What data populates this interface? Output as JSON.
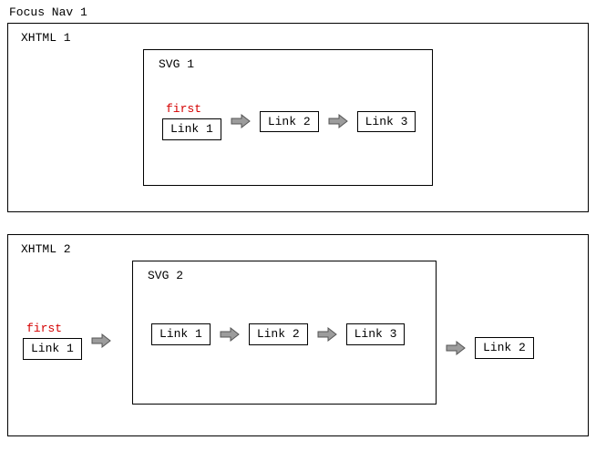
{
  "page_title": "Focus Nav 1",
  "box1": {
    "label": "XHTML 1",
    "svg_label": "SVG 1",
    "first_label": "first",
    "links": [
      "Link 1",
      "Link 2",
      "Link 3"
    ]
  },
  "box2": {
    "label": "XHTML 2",
    "svg_label": "SVG 2",
    "first_label": "first",
    "outer_left_link": "Link 1",
    "svg_links": [
      "Link 1",
      "Link 2",
      "Link 3"
    ],
    "outer_right_link": "Link 2"
  }
}
